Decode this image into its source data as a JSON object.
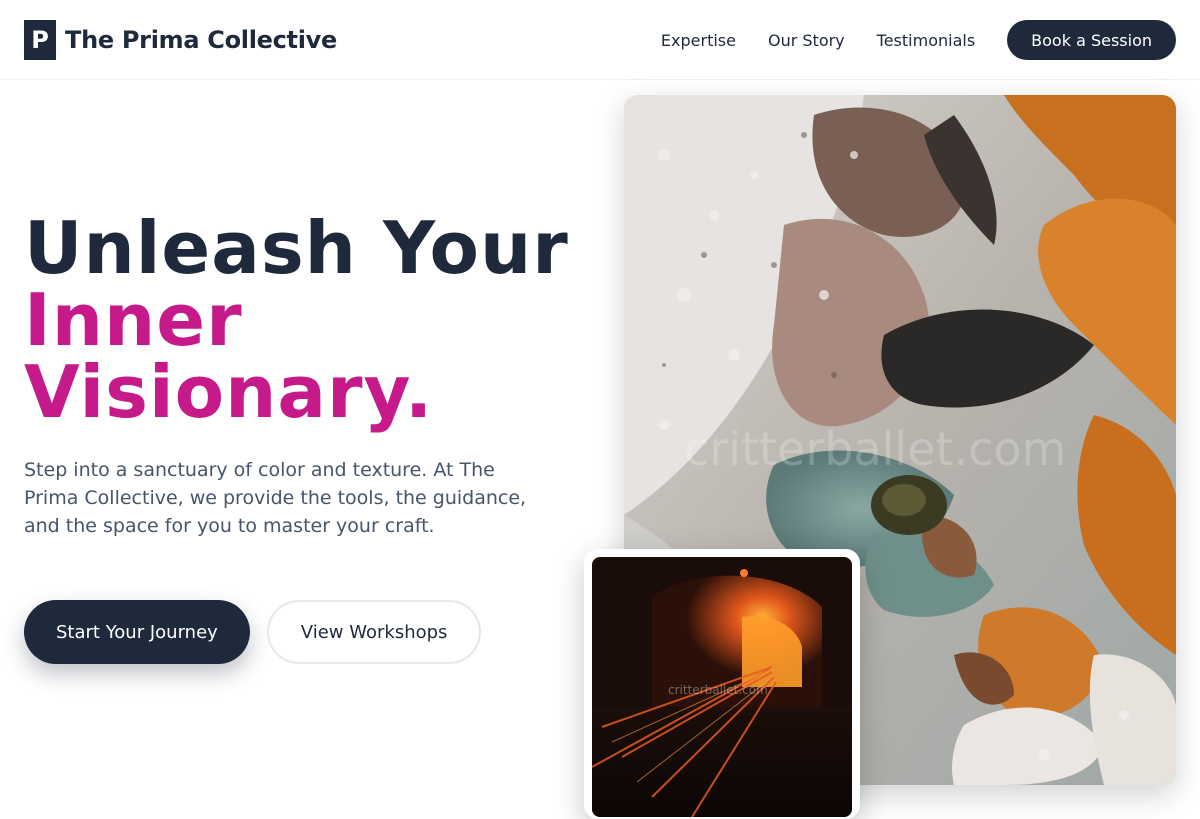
{
  "brand": {
    "logo_letter": "P",
    "name": "The Prima Collective"
  },
  "nav": {
    "links": [
      "Expertise",
      "Our Story",
      "Testimonials"
    ],
    "cta": "Book a Session"
  },
  "hero": {
    "title_line1": "Unleash Your",
    "title_line2": "Inner",
    "title_line3": "Visionary.",
    "description": "Step into a sanctuary of color and texture. At The Prima Collective, we provide the tools, the guidance, and the space for you to master your craft.",
    "primary_cta": "Start Your Journey",
    "secondary_cta": "View Workshops"
  },
  "images": {
    "main_alt": "Textured abstract painting with thick impasto strokes",
    "small_alt": "Glowing kiln with streaks of light",
    "watermark": "critterballet.com"
  },
  "colors": {
    "navy": "#1e293b",
    "accent_magenta": "#c71a8a",
    "body_text": "#475569"
  }
}
